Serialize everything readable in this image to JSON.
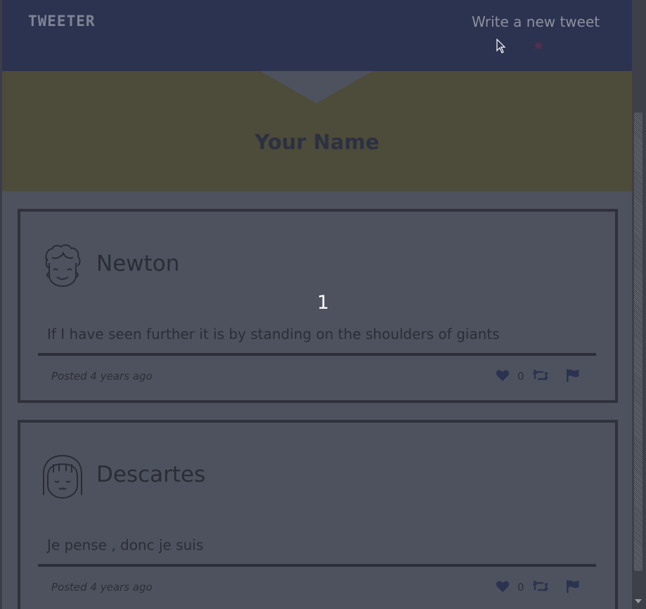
{
  "header": {
    "brand": "TWEETER",
    "compose_label": "Write a new tweet"
  },
  "profile": {
    "name": "Your Name"
  },
  "overlay": {
    "counter": "1"
  },
  "tweets": [
    {
      "author": "Newton",
      "text": "If I have seen further it is by standing on the shoulders of giants",
      "posted": "Posted 4 years ago",
      "likes": "0",
      "avatar": "curly-hair-face-icon"
    },
    {
      "author": "Descartes",
      "text": "Je pense , donc je suis",
      "posted": "Posted 4 years ago",
      "likes": "0",
      "avatar": "bangs-hair-face-icon"
    }
  ],
  "colors": {
    "navbar": "#2c3350",
    "banner": "#4d4b3a",
    "page_background": "#4e525e",
    "icon_accent": "#2c3350"
  }
}
